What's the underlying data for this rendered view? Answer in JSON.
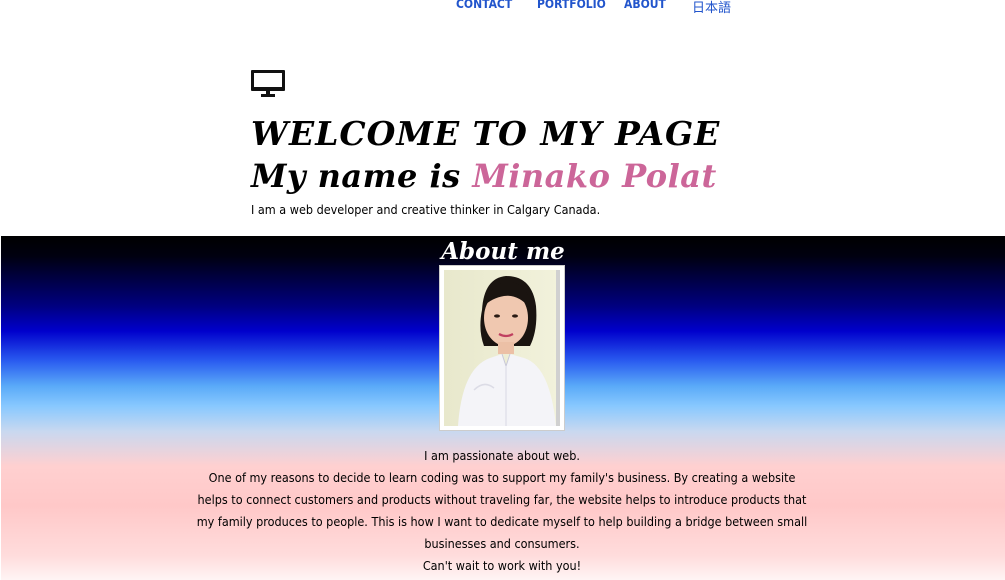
{
  "nav": {
    "contact": "CONTACT",
    "portfolio": "PORTFOLIO",
    "about": "ABOUT",
    "japanese": "日本語"
  },
  "hero": {
    "icon": "desktop-monitor-icon",
    "welcome": "WELCOME TO MY PAGE",
    "name_prefix": "My name is ",
    "name": "Minako Polat",
    "tagline": "I am a web developer and creative thinker in Calgary Canada."
  },
  "about": {
    "title": "About me",
    "photo_alt": "Profile photo",
    "line1": "I am passionate about web.",
    "paragraph": "One of my reasons to decide to learn coding was to support my family's business. By creating a website helps to connect customers and products without traveling far, the website helps to introduce products that my family produces to people. This is how I want to dedicate myself to help building a bridge between small businesses and consumers.",
    "closing": "Can't wait to work with you!"
  },
  "colors": {
    "nav_link": "#2255cc",
    "name_accent": "#cc6699",
    "about_title": "#ffffff"
  }
}
